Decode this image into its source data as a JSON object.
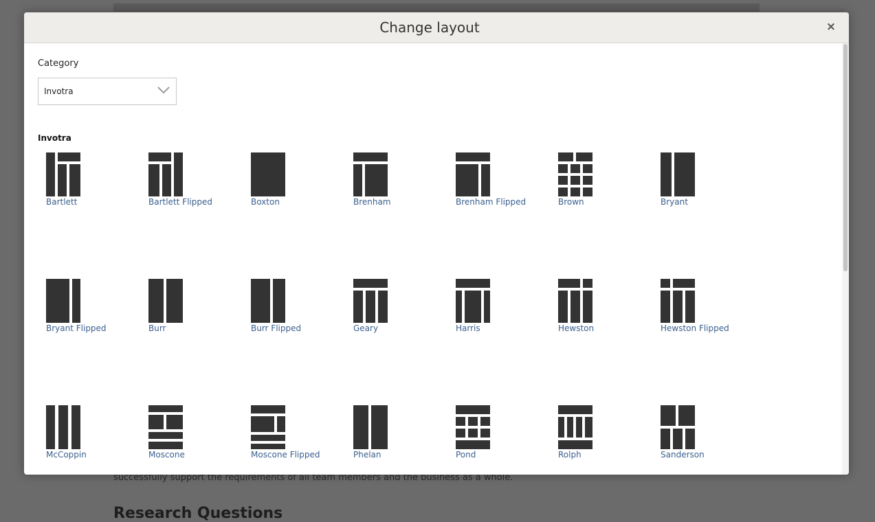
{
  "background": {
    "body_text": "successfully support the requirements of all team members and the business as a whole.",
    "heading": "Research Questions"
  },
  "modal": {
    "title": "Change layout",
    "close_symbol": "×",
    "category_label": "Category",
    "category_value": "Invotra",
    "section_title": "Invotra"
  },
  "layouts": [
    {
      "label": "Bartlett",
      "icon": "bartlett-layout-icon"
    },
    {
      "label": "Bartlett Flipped",
      "icon": "bartlett-flipped-layout-icon"
    },
    {
      "label": "Boxton",
      "icon": "boxton-layout-icon"
    },
    {
      "label": "Brenham",
      "icon": "brenham-layout-icon"
    },
    {
      "label": "Brenham Flipped",
      "icon": "brenham-flipped-layout-icon"
    },
    {
      "label": "Brown",
      "icon": "brown-layout-icon"
    },
    {
      "label": "Bryant",
      "icon": "bryant-layout-icon"
    },
    {
      "label": "Bryant Flipped",
      "icon": "bryant-flipped-layout-icon"
    },
    {
      "label": "Burr",
      "icon": "burr-layout-icon"
    },
    {
      "label": "Burr Flipped",
      "icon": "burr-flipped-layout-icon"
    },
    {
      "label": "Geary",
      "icon": "geary-layout-icon"
    },
    {
      "label": "Harris",
      "icon": "harris-layout-icon"
    },
    {
      "label": "Hewston",
      "icon": "hewston-layout-icon"
    },
    {
      "label": "Hewston Flipped",
      "icon": "hewston-flipped-layout-icon"
    },
    {
      "label": "McCoppin",
      "icon": "mccoppin-layout-icon"
    },
    {
      "label": "Moscone",
      "icon": "moscone-layout-icon"
    },
    {
      "label": "Moscone Flipped",
      "icon": "moscone-flipped-layout-icon"
    },
    {
      "label": "Phelan",
      "icon": "phelan-layout-icon"
    },
    {
      "label": "Pond",
      "icon": "pond-layout-icon"
    },
    {
      "label": "Rolph",
      "icon": "rolph-layout-icon"
    },
    {
      "label": "Sanderson",
      "icon": "sanderson-layout-icon"
    }
  ],
  "colors": {
    "icon_fill": "#333333",
    "link": "#3a5f8f",
    "header_bg": "#efede9",
    "overlay": "#6b6b6b"
  }
}
